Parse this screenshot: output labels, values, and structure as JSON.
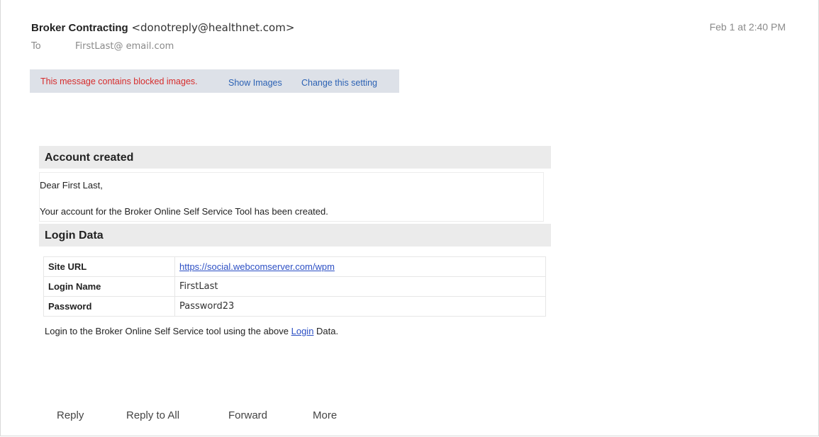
{
  "email": {
    "sender_name": "Broker Contracting",
    "sender_email": "<donotreply@healthnet.com>",
    "date": "Feb 1 at 2:40 PM",
    "to_label": "To",
    "to_address": "FirstLast@ email.com"
  },
  "blocked_bar": {
    "message": "This message contains blocked images.",
    "show_images": "Show Images",
    "change_setting": "Change this setting"
  },
  "account_section": {
    "title": "Account created",
    "greeting": "Dear First Last,",
    "body": "Your account for the Broker Online Self Service Tool has been created."
  },
  "login_section": {
    "title": "Login Data",
    "rows": [
      {
        "label": "Site URL",
        "value": "https://social.webcomserver.com/wpm"
      },
      {
        "label": "Login Name",
        "value": "FirstLast"
      },
      {
        "label": "Password",
        "value": "Password23"
      }
    ],
    "note_before": "Login to the Broker Online Self Service tool using the above ",
    "note_link": "Login",
    "note_after": " Data."
  },
  "actions": {
    "reply": "Reply",
    "reply_all": "Reply to All",
    "forward": "Forward",
    "more": "More"
  }
}
